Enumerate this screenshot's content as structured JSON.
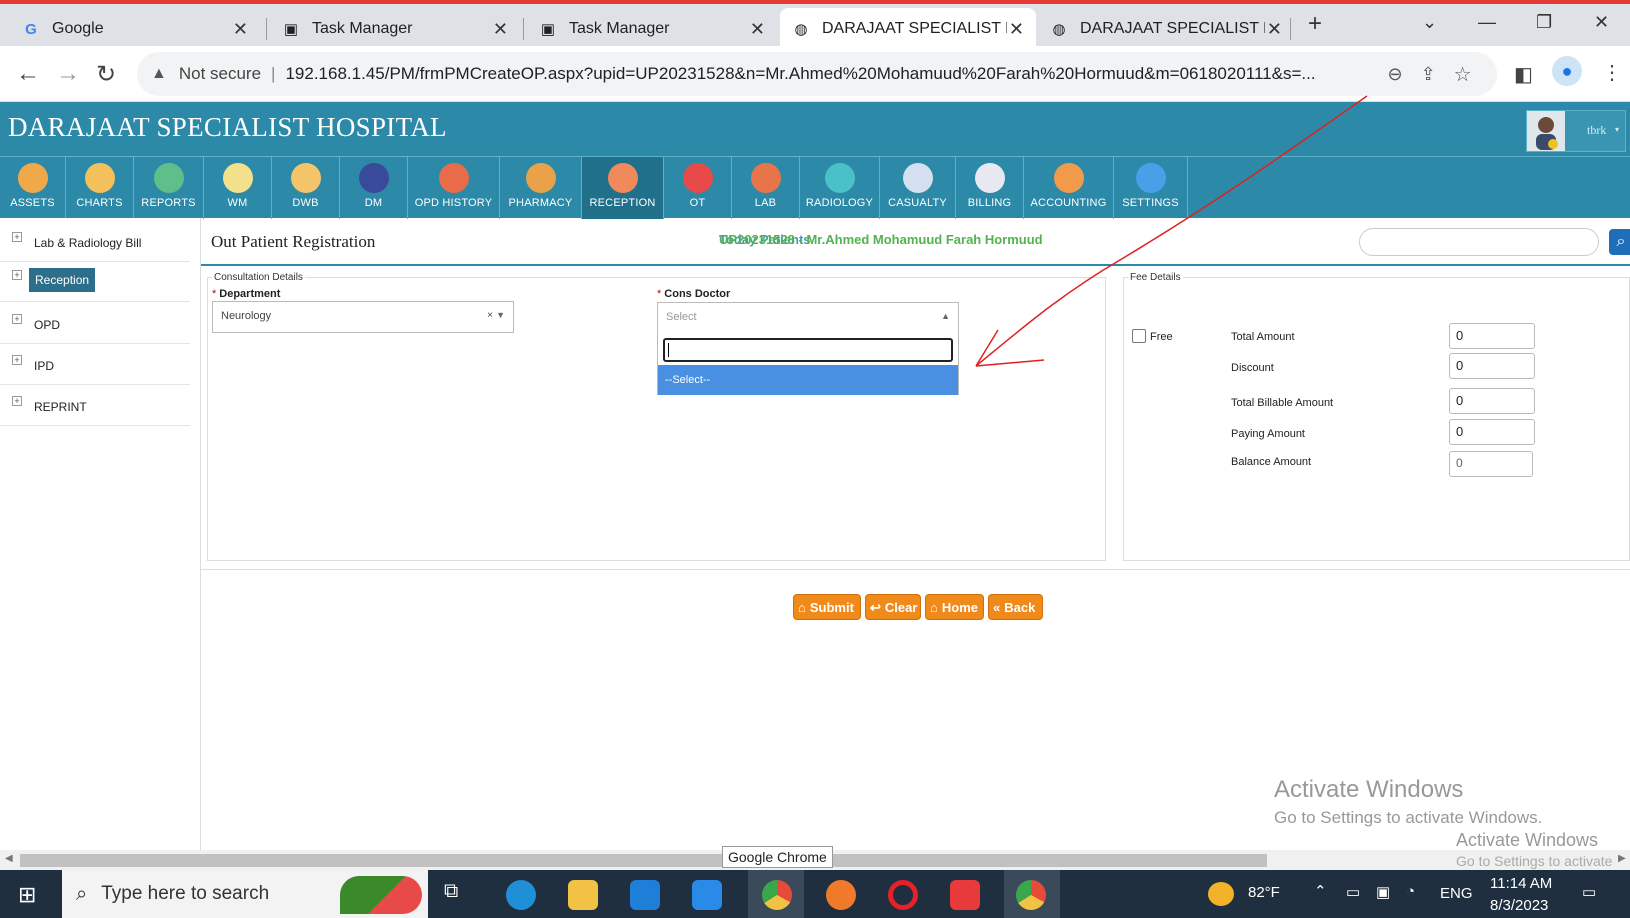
{
  "browser": {
    "tabs": [
      {
        "title": "Google",
        "icon": "google-icon"
      },
      {
        "title": "Task Manager",
        "icon": "task-manager-icon"
      },
      {
        "title": "Task Manager",
        "icon": "task-manager-icon"
      },
      {
        "title": "DARAJAAT SPECIALIST HC",
        "icon": "globe-icon"
      },
      {
        "title": "DARAJAAT SPECIALIST HC",
        "icon": "globe-icon"
      }
    ],
    "security_label": "Not secure",
    "url": "192.168.1.45/PM/frmPMCreateOP.aspx?upid=UP20231528&n=Mr.Ahmed%20Mohamuud%20Farah%20Hormuud&m=0618020111&s=..."
  },
  "app": {
    "hospital_name": "DARAJAAT SPECIALIST HOSPITAL",
    "username": "tbrk",
    "modules": [
      {
        "label": "ASSETS",
        "color": "#f0a94a"
      },
      {
        "label": "CHARTS",
        "color": "#f3c05b"
      },
      {
        "label": "REPORTS",
        "color": "#5fbf8a"
      },
      {
        "label": "WM",
        "color": "#f2e08a"
      },
      {
        "label": "DWB",
        "color": "#f5c46a"
      },
      {
        "label": "DM",
        "color": "#3a4a9a"
      },
      {
        "label": "OPD HISTORY",
        "color": "#e86c4a"
      },
      {
        "label": "PHARMACY",
        "color": "#e8a34a"
      },
      {
        "label": "RECEPTION",
        "color": "#f08a5a"
      },
      {
        "label": "OT",
        "color": "#e84a4a"
      },
      {
        "label": "LAB",
        "color": "#e8744a"
      },
      {
        "label": "RADIOLOGY",
        "color": "#4ac0c8"
      },
      {
        "label": "CASUALTY",
        "color": "#d4e0f0"
      },
      {
        "label": "BILLING",
        "color": "#e8e8f0"
      },
      {
        "label": "ACCOUNTING",
        "color": "#f09a4a"
      },
      {
        "label": "SETTINGS",
        "color": "#4aa0e8"
      }
    ],
    "selected_module": "RECEPTION"
  },
  "sidebar": {
    "items": [
      {
        "label": "Lab & Radiology Bill"
      },
      {
        "label": "Reception"
      },
      {
        "label": "OPD"
      },
      {
        "label": "IPD"
      },
      {
        "label": "REPRINT"
      }
    ]
  },
  "page": {
    "title": "Out Patient Registration",
    "status_text": "Today Patients",
    "status_overlay": "UP20231528 - Mr.Ahmed Mohamuud Farah Hormuud"
  },
  "consultation": {
    "legend": "Consultation Details",
    "department_label": "Department",
    "department_value": "Neurology",
    "doctor_label": "Cons Doctor",
    "doctor_placeholder": "Select",
    "doctor_options": [
      "--Select--"
    ]
  },
  "fees": {
    "legend": "Fee Details",
    "free_label": "Free",
    "free_checked": false,
    "rows": [
      {
        "label": "Total Amount",
        "value": "0"
      },
      {
        "label": "Discount",
        "value": "0"
      },
      {
        "label": "Total Billable Amount",
        "value": "0"
      },
      {
        "label": "Paying Amount",
        "value": "0"
      },
      {
        "label": "Balance Amount",
        "value": "0"
      }
    ]
  },
  "actions": {
    "submit": "Submit",
    "clear": "Clear",
    "home": "Home",
    "back": "Back"
  },
  "watermark": {
    "line1": "Activate Windows",
    "line2": "Go to Settings to activate Windows.",
    "line3": "Activate Windows",
    "line4": "Go to Settings to activate"
  },
  "tooltip": "Google Chrome",
  "taskbar": {
    "search_placeholder": "Type here to search",
    "weather": "82°F",
    "language": "ENG",
    "time": "11:14 AM",
    "date": "8/3/2023"
  }
}
